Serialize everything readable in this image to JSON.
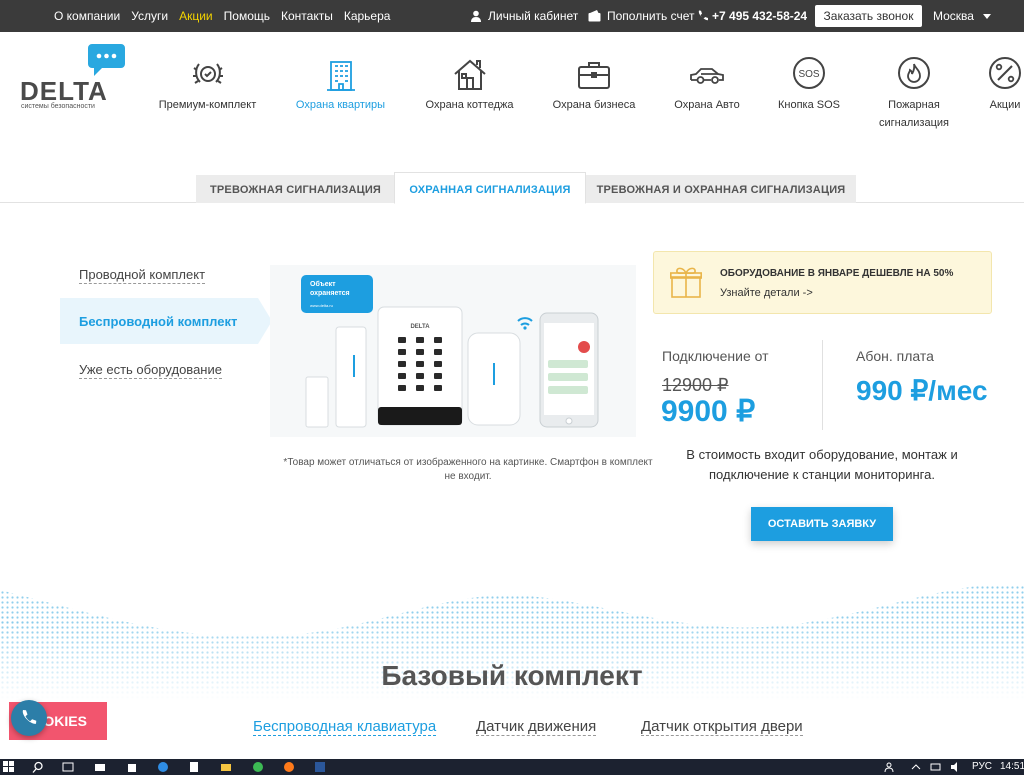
{
  "topbar": {
    "nav": [
      "О компании",
      "Услуги",
      "Акции",
      "Помощь",
      "Контакты",
      "Карьера"
    ],
    "highlight_index": 2,
    "cabinet": "Личный кабинет",
    "topup": "Пополнить счет",
    "phone": "+7 495 432-58-24",
    "call_button": "Заказать звонок",
    "city": "Москва"
  },
  "logo": {
    "name": "DELTA",
    "tagline": "системы безопасности"
  },
  "categories": [
    {
      "label": "Премиум-комплект",
      "icon": "laurel-badge-icon"
    },
    {
      "label": "Охрана квартиры",
      "icon": "apartment-building-icon",
      "active": true
    },
    {
      "label": "Охрана коттеджа",
      "icon": "house-icon"
    },
    {
      "label": "Охрана бизнеса",
      "icon": "briefcase-icon"
    },
    {
      "label": "Охрана Авто",
      "icon": "car-icon"
    },
    {
      "label": "Кнопка SOS",
      "icon": "sos-icon"
    },
    {
      "label": "Пожарная сигнализация",
      "icon": "fire-icon"
    },
    {
      "label": "Акции",
      "icon": "percent-icon"
    }
  ],
  "tabs": [
    "ТРЕВОЖНАЯ СИГНАЛИЗАЦИЯ",
    "ОХРАННАЯ СИГНАЛИЗАЦИЯ",
    "ТРЕВОЖНАЯ И ОХРАННАЯ СИГНАЛИЗАЦИЯ"
  ],
  "active_tab": 1,
  "side_options": [
    "Проводной комплект",
    "Беспроводной комплект",
    "Уже есть оборудование"
  ],
  "active_side": 1,
  "product": {
    "badge_line1": "Объект",
    "badge_line2": "охраняется",
    "badge_url": "www.delta.ru",
    "brand": "DELTA",
    "disclaimer": "*Товар может отличаться от изображенного на картинке. Смартфон в комплект не входит."
  },
  "promo": {
    "title": "ОБОРУДОВАНИЕ В ЯНВАРЕ ДЕШЕВЛЕ НА 50%",
    "link": "Узнайте детали ->"
  },
  "pricing": {
    "connection_label": "Подключение от",
    "old_price": "12900 ₽",
    "new_price": "9900 ₽",
    "fee_label": "Абон. плата",
    "fee": "990 ₽/мес",
    "note": "В стоимость входит оборудование, монтаж и подключение к станции мониторинга.",
    "cta": "ОСТАВИТЬ ЗАЯВКУ"
  },
  "base_kit": {
    "title": "Базовый комплект",
    "items": [
      "Беспроводная клавиатура",
      "Датчик движения",
      "Датчик открытия двери"
    ],
    "active_index": 0
  },
  "cookies": {
    "label": "OKIES"
  },
  "taskbar": {
    "lang": "РУС",
    "time": "14:51"
  },
  "colors": {
    "accent": "#1d9ee0",
    "topbar": "#3b3b3b",
    "highlight": "#f3d300",
    "cookie": "#f2556e"
  }
}
